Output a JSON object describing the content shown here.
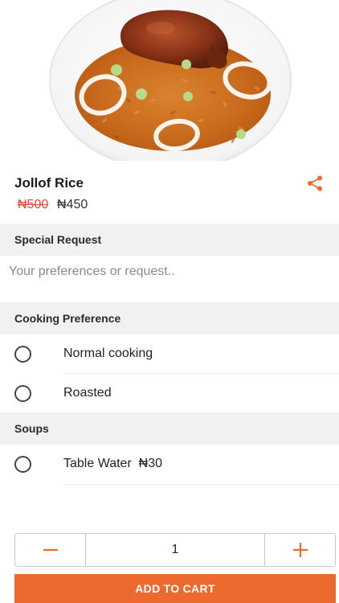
{
  "product": {
    "name": "Jollof Rice",
    "price_old": "₦500",
    "price_new": "₦450"
  },
  "special_request": {
    "header": "Special Request",
    "placeholder": "Your preferences or request.."
  },
  "cooking_preference": {
    "header": "Cooking Preference",
    "options": [
      {
        "label": "Normal cooking",
        "selected": false
      },
      {
        "label": "Roasted",
        "selected": false
      }
    ]
  },
  "soups": {
    "header": "Soups",
    "options": [
      {
        "label": "Table Water  ₦30",
        "selected": false
      }
    ]
  },
  "quantity": {
    "value": "1"
  },
  "cart": {
    "add_label": "ADD TO CART"
  },
  "colors": {
    "accent": "#ed6a2e",
    "strike_price": "#e0463c",
    "section_bg": "#f1f1f1"
  },
  "icons": {
    "back": "back-arrow-icon",
    "share": "share-icon",
    "minus": "minus-icon",
    "plus": "plus-icon"
  }
}
